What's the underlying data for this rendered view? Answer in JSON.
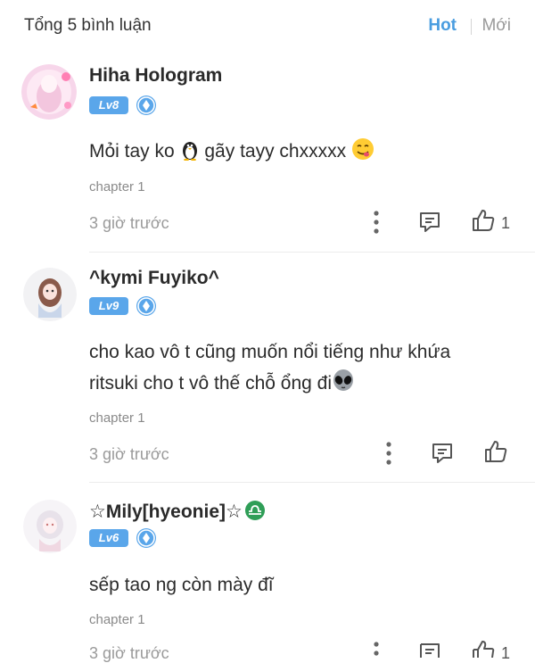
{
  "header": {
    "count_label": "Tổng 5 bình luận",
    "tabs": [
      {
        "label": "Hot",
        "active": true
      },
      {
        "label": "Mới",
        "active": false
      }
    ],
    "accent_color": "#4a9de0"
  },
  "comments": [
    {
      "username": "Hiha Hologram",
      "level": "Lv8",
      "text_before": "Mỏi tay ko ",
      "text_after": " gãy tayy chxxxxx ",
      "emojis": [
        "penguin",
        "face-savoring-food"
      ],
      "chapter": "chapter 1",
      "time": "3 giờ trước",
      "likes": "1"
    },
    {
      "username": "^kymi Fuyiko^",
      "level": "Lv9",
      "text_line1": "cho kao vô t cũng muốn nổi tiếng như khứa",
      "text_line2": "ritsuki cho t vô thế chỗ ổng đi",
      "emojis": [
        "alien"
      ],
      "chapter": "chapter 1",
      "time": "3 giờ trước",
      "likes": ""
    },
    {
      "username": "☆Mily[hyeonie]☆",
      "username_symbol": "♎",
      "level": "Lv6",
      "text": "sếp tao ng còn mày đĩ",
      "chapter": "chapter 1",
      "time": "3 giờ trước",
      "likes": "1"
    }
  ]
}
